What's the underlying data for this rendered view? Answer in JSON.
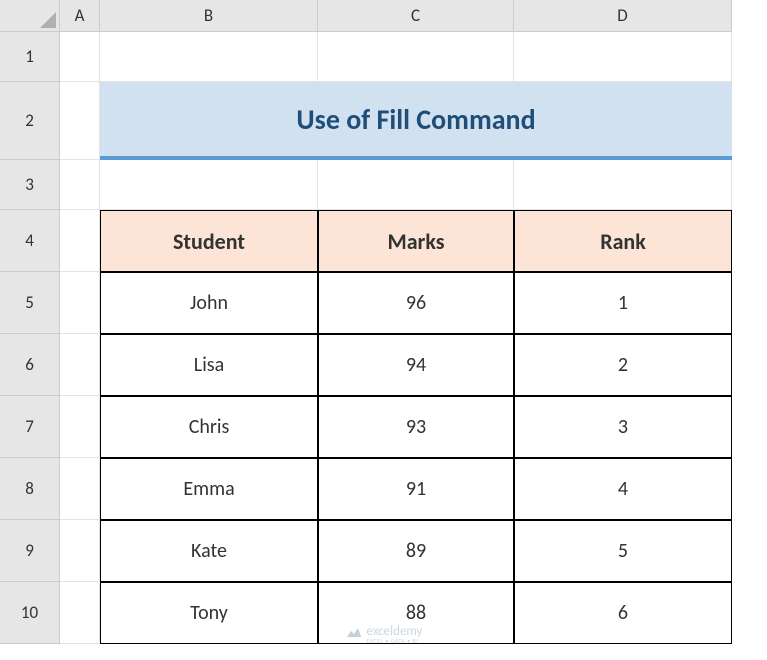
{
  "columns": [
    "A",
    "B",
    "C",
    "D"
  ],
  "rows": [
    "1",
    "2",
    "3",
    "4",
    "5",
    "6",
    "7",
    "8",
    "9",
    "10"
  ],
  "title": "Use of Fill Command",
  "table": {
    "headers": [
      "Student",
      "Marks",
      "Rank"
    ],
    "data": [
      {
        "student": "John",
        "marks": "96",
        "rank": "1"
      },
      {
        "student": "Lisa",
        "marks": "94",
        "rank": "2"
      },
      {
        "student": "Chris",
        "marks": "93",
        "rank": "3"
      },
      {
        "student": "Emma",
        "marks": "91",
        "rank": "4"
      },
      {
        "student": "Kate",
        "marks": "89",
        "rank": "5"
      },
      {
        "student": "Tony",
        "marks": "88",
        "rank": "6"
      }
    ]
  },
  "watermark": {
    "brand": "exceldemy",
    "tagline": "EXCEL • DATA • BI"
  },
  "chart_data": {
    "type": "table",
    "title": "Use of Fill Command",
    "columns": [
      "Student",
      "Marks",
      "Rank"
    ],
    "rows": [
      [
        "John",
        96,
        1
      ],
      [
        "Lisa",
        94,
        2
      ],
      [
        "Chris",
        93,
        3
      ],
      [
        "Emma",
        91,
        4
      ],
      [
        "Kate",
        89,
        5
      ],
      [
        "Tony",
        88,
        6
      ]
    ]
  }
}
